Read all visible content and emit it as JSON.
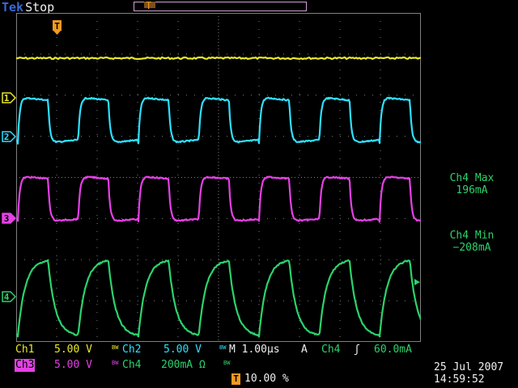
{
  "header": {
    "brand": "Tek",
    "acq_state": "Stop",
    "trigger_marker": "T"
  },
  "channels": [
    {
      "id": "ch1",
      "marker": "1",
      "color": "#ffff00"
    },
    {
      "id": "ch2",
      "marker": "2",
      "color": "#2ee0ff"
    },
    {
      "id": "ch3",
      "marker": "3",
      "color": "#ff00ff"
    },
    {
      "id": "ch4",
      "marker": "4",
      "color": "#2bd36c"
    }
  ],
  "colors": {
    "ch1": "#e8e82a",
    "ch2": "#2ee0ff",
    "ch3": "#e640e6",
    "ch4": "#2bd36c",
    "trigger": "#f29a1f",
    "grid": "#808080"
  },
  "measurements": [
    {
      "label": "Ch4 Max",
      "value": "196mA"
    },
    {
      "label": "Ch4 Min",
      "value": "−208mA"
    }
  ],
  "readout": {
    "ch1_label": "Ch1",
    "ch1_scale": "5.00 V",
    "ch1_bw": "BW",
    "ch2_label": "Ch2",
    "ch2_scale": "5.00 V",
    "ch2_bw": "BW",
    "ch3_label": "Ch3",
    "ch3_scale": "5.00 V",
    "ch3_bw": "BW",
    "ch4_label": "Ch4",
    "ch4_scale": "200mA Ω",
    "ch4_bw": "BW",
    "timebase": "M 1.00µs",
    "trig_source_prefix": "A",
    "trig_source": "Ch4",
    "trig_slope": "ʃ",
    "trig_level": "60.0mA",
    "trig_position": "10.00 %",
    "trig_box": "T",
    "date": "25 Jul  2007",
    "time": "14:59:52"
  }
}
